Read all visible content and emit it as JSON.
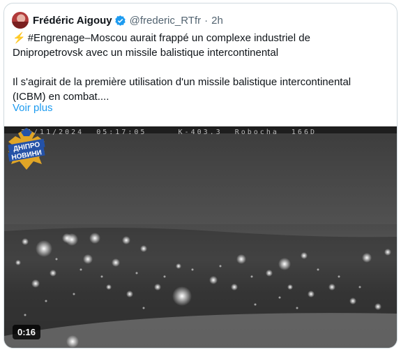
{
  "tweet": {
    "author_name": "Frédéric Aigouy",
    "author_handle": "@frederic_RTfr",
    "separator": "·",
    "time": "2h",
    "line1_hashtag": "#Engrenage",
    "line1_rest": "–Moscou aurait frappé un complexe industriel de",
    "line2": "Dnipropetrovsk avec un missile balistique intercontinental",
    "line3": "Il s'agirait de la première utilisation d'un missile balistique intercontinental",
    "line4": "(ICBM) en combat....",
    "show_more": "Voir plus",
    "emoji": "⚡"
  },
  "video": {
    "osd_timestamp": "21/11/2024  05:17:05",
    "osd_info": "K-403.3  Robocha  166D",
    "duration": "0:16",
    "watermark_line1": "ДНІПРО",
    "watermark_line2": "НОВИНИ"
  },
  "colors": {
    "link": "#1d9bf0",
    "verified": "#1d9bf0",
    "text": "#0f1419",
    "muted": "#536471"
  }
}
